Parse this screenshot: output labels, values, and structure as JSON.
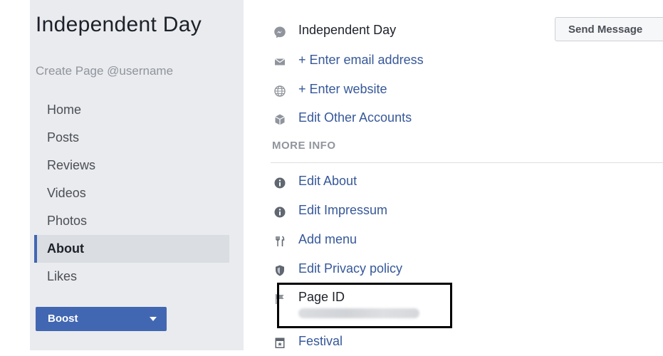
{
  "sidebar": {
    "page_name": "Independent Day",
    "username_prompt": "Create Page @username",
    "nav": [
      {
        "label": "Home"
      },
      {
        "label": "Posts"
      },
      {
        "label": "Reviews"
      },
      {
        "label": "Videos"
      },
      {
        "label": "Photos"
      },
      {
        "label": "About",
        "active": true
      },
      {
        "label": "Likes"
      }
    ],
    "boost_label": "Boost"
  },
  "about": {
    "messenger_name": "Independent Day",
    "send_message_label": "Send Message",
    "email_link": "+ Enter email address",
    "website_link": "+ Enter website",
    "other_accounts_link": "Edit Other Accounts",
    "more_info_title": "MORE INFO",
    "edit_about": "Edit About",
    "edit_impressum": "Edit Impressum",
    "add_menu": "Add menu",
    "edit_privacy": "Edit Privacy policy",
    "page_id_label": "Page ID",
    "category": "Festival"
  },
  "colors": {
    "brand": "#4267b2",
    "link": "#365899",
    "sidebar_bg": "#e9ebee"
  }
}
